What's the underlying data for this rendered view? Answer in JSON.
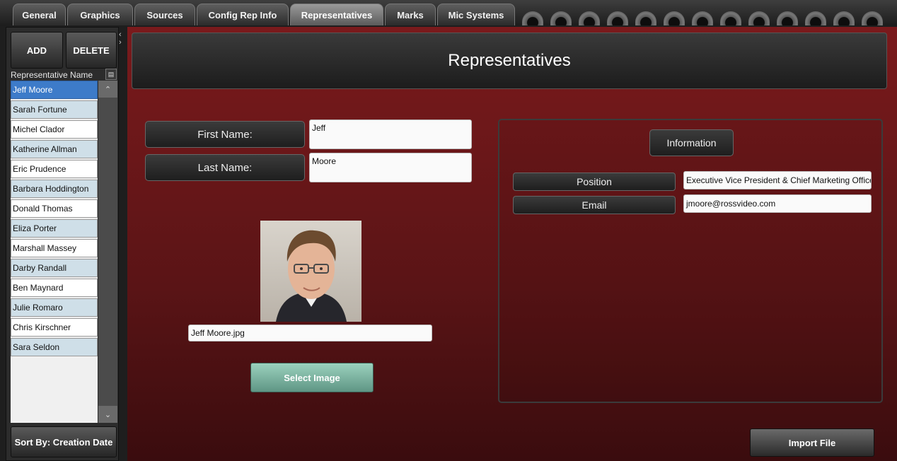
{
  "tabs": [
    {
      "label": "General",
      "active": false
    },
    {
      "label": "Graphics",
      "active": false
    },
    {
      "label": "Sources",
      "active": false
    },
    {
      "label": "Config Rep Info",
      "active": false
    },
    {
      "label": "Representatives",
      "active": true
    },
    {
      "label": "Marks",
      "active": false
    },
    {
      "label": "Mic Systems",
      "active": false
    }
  ],
  "sidebar": {
    "add_label": "ADD",
    "delete_label": "DELETE",
    "list_header": "Representative Name",
    "selected_index": 0,
    "representatives": [
      "Jeff Moore",
      "Sarah Fortune",
      "Michel Clador",
      "Katherine Allman",
      "Eric Prudence",
      "Barbara Hoddington",
      "Donald Thomas",
      "Eliza Porter",
      "Marshall Massey",
      "Darby Randall",
      "Ben Maynard",
      "Julie Romaro",
      "Chris Kirschner",
      "Sara Seldon"
    ],
    "sort_label": "Sort By: Creation Date"
  },
  "main": {
    "title": "Representatives",
    "first_name_label": "First Name:",
    "first_name_value": "Jeff",
    "last_name_label": "Last Name:",
    "last_name_value": "Moore",
    "image_filename": "Jeff Moore.jpg",
    "select_image_label": "Select Image",
    "info": {
      "title": "Information",
      "position_label": "Position",
      "position_value": "Executive Vice President & Chief Marketing Officer",
      "email_label": "Email",
      "email_value": "jmoore@rossvideo.com"
    },
    "import_label": "Import File"
  },
  "colors": {
    "accent_selected": "#3d7bc9",
    "main_background": "#6e1719",
    "select_image_button": "#7fb8a3"
  }
}
